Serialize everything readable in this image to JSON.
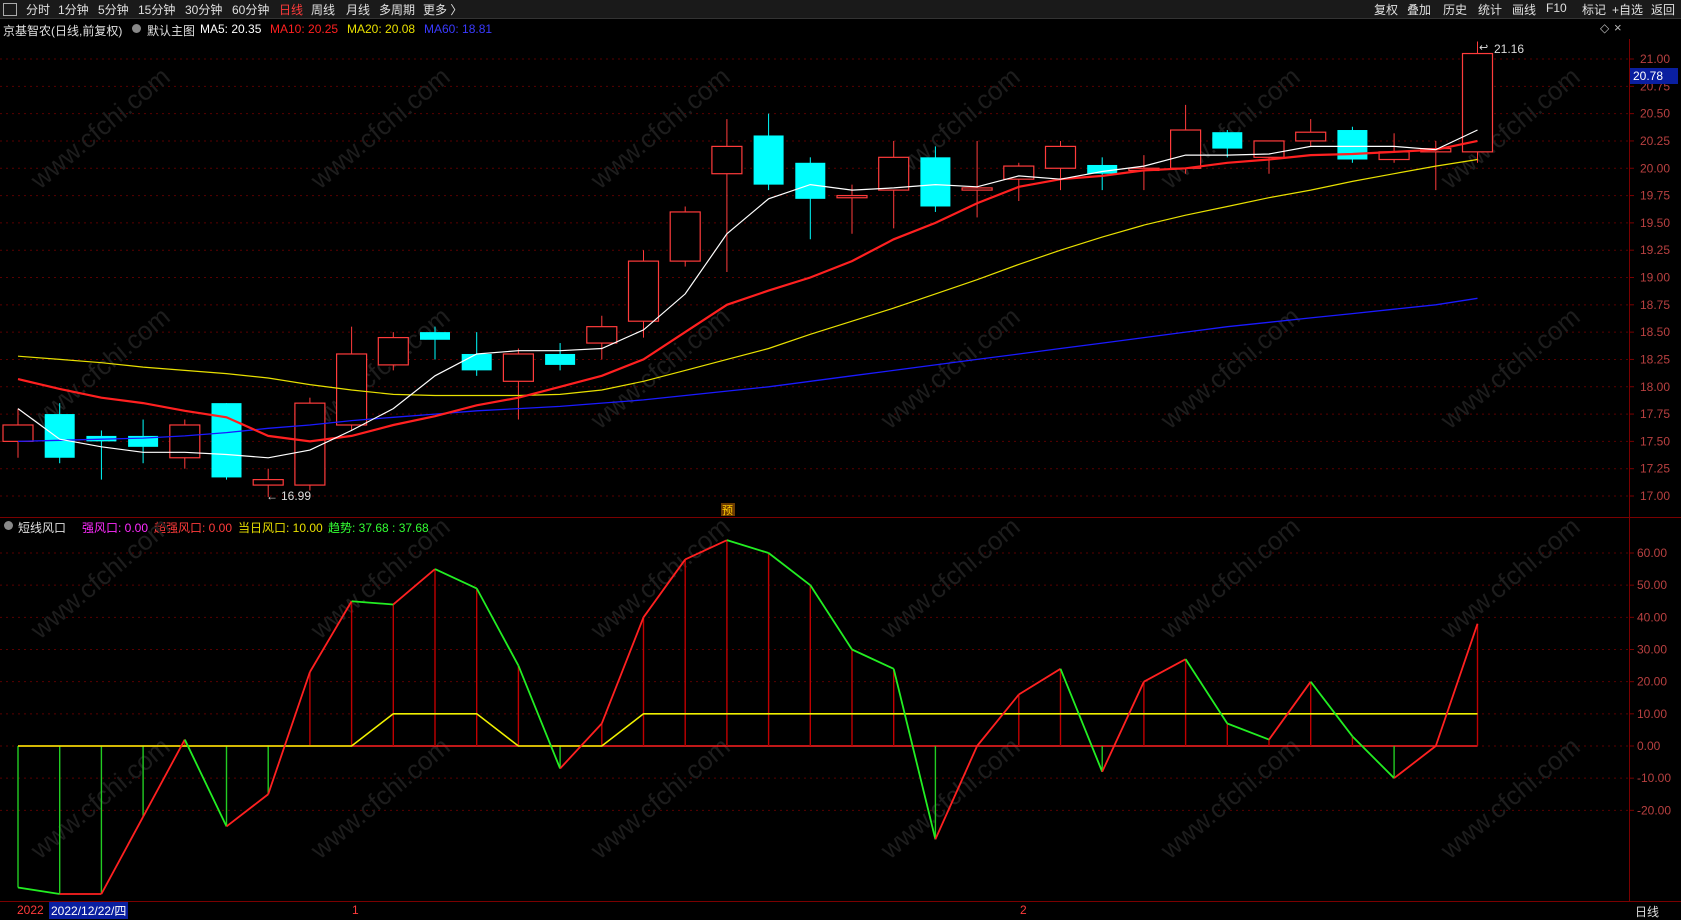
{
  "toolbar": {
    "left_icon": "sidebar-toggle-icon",
    "periods": [
      "分时",
      "1分钟",
      "5分钟",
      "15分钟",
      "30分钟",
      "60分钟",
      "日线",
      "周线",
      "月线",
      "多周期",
      "更多 〉"
    ],
    "active_period": "日线",
    "right_items": [
      "复权",
      "叠加",
      "历史",
      "统计",
      "画线",
      "F10",
      "+自选",
      "返回"
    ],
    "mark_label": "标记"
  },
  "main_chart": {
    "stock_title": "京基智农(日线,前复权)",
    "template_label": "默认主图",
    "ma5_label": "MA5: 20.35",
    "ma10_label": "MA10: 20.25",
    "ma20_label": "MA20: 20.08",
    "ma60_label": "MA60: 18.81",
    "colors": {
      "up": "#ff3b3b",
      "down": "#00ffff",
      "ma5": "#ffffff",
      "ma10": "#ff2020",
      "ma20": "#e8e000",
      "ma60": "#1a1aff"
    },
    "y_ticks": [
      "21.00",
      "20.75",
      "20.50",
      "20.25",
      "20.00",
      "19.75",
      "19.50",
      "19.25",
      "19.00",
      "18.75",
      "18.50",
      "18.25",
      "18.00",
      "17.75",
      "17.50",
      "17.25",
      "17.00"
    ],
    "current_price": "20.78",
    "high_marker": "21.16",
    "low_marker": "16.99",
    "pre_badge": "预"
  },
  "chart_data": [
    {
      "type": "candlestick",
      "title": "京基智农(日线,前复权)",
      "ylim": [
        16.9,
        21.2
      ],
      "candles": [
        {
          "o": 17.5,
          "c": 17.65,
          "h": 17.8,
          "l": 17.35
        },
        {
          "o": 17.75,
          "c": 17.35,
          "h": 17.85,
          "l": 17.3
        },
        {
          "o": 17.55,
          "c": 17.5,
          "h": 17.6,
          "l": 17.15
        },
        {
          "o": 17.55,
          "c": 17.45,
          "h": 17.7,
          "l": 17.3
        },
        {
          "o": 17.35,
          "c": 17.65,
          "h": 17.7,
          "l": 17.25
        },
        {
          "o": 17.85,
          "c": 17.17,
          "h": 17.85,
          "l": 17.15
        },
        {
          "o": 17.1,
          "c": 17.15,
          "h": 17.25,
          "l": 16.99
        },
        {
          "o": 17.1,
          "c": 17.85,
          "h": 17.9,
          "l": 17.05
        },
        {
          "o": 17.65,
          "c": 18.3,
          "h": 18.55,
          "l": 17.6
        },
        {
          "o": 18.2,
          "c": 18.45,
          "h": 18.5,
          "l": 18.15
        },
        {
          "o": 18.5,
          "c": 18.43,
          "h": 18.55,
          "l": 18.25
        },
        {
          "o": 18.3,
          "c": 18.15,
          "h": 18.5,
          "l": 18.1
        },
        {
          "o": 18.05,
          "c": 18.3,
          "h": 18.35,
          "l": 17.7
        },
        {
          "o": 18.3,
          "c": 18.2,
          "h": 18.4,
          "l": 18.15
        },
        {
          "o": 18.4,
          "c": 18.55,
          "h": 18.65,
          "l": 18.25
        },
        {
          "o": 18.6,
          "c": 19.15,
          "h": 19.25,
          "l": 18.45
        },
        {
          "o": 19.15,
          "c": 19.6,
          "h": 19.65,
          "l": 19.1
        },
        {
          "o": 19.95,
          "c": 20.2,
          "h": 20.45,
          "l": 19.05
        },
        {
          "o": 20.3,
          "c": 19.85,
          "h": 20.5,
          "l": 19.8
        },
        {
          "o": 20.05,
          "c": 19.72,
          "h": 20.1,
          "l": 19.35
        },
        {
          "o": 19.73,
          "c": 19.75,
          "h": 19.85,
          "l": 19.4
        },
        {
          "o": 19.8,
          "c": 20.1,
          "h": 20.25,
          "l": 19.45
        },
        {
          "o": 20.1,
          "c": 19.65,
          "h": 20.2,
          "l": 19.6
        },
        {
          "o": 19.8,
          "c": 19.82,
          "h": 20.25,
          "l": 19.55
        },
        {
          "o": 19.9,
          "c": 20.02,
          "h": 20.05,
          "l": 19.7
        },
        {
          "o": 20.0,
          "c": 20.2,
          "h": 20.25,
          "l": 19.8
        },
        {
          "o": 20.03,
          "c": 19.95,
          "h": 20.1,
          "l": 19.8
        },
        {
          "o": 19.98,
          "c": 20.0,
          "h": 20.12,
          "l": 19.8
        },
        {
          "o": 20.0,
          "c": 20.35,
          "h": 20.58,
          "l": 19.95
        },
        {
          "o": 20.33,
          "c": 20.18,
          "h": 20.35,
          "l": 20.1
        },
        {
          "o": 20.1,
          "c": 20.25,
          "h": 20.25,
          "l": 19.95
        },
        {
          "o": 20.25,
          "c": 20.33,
          "h": 20.45,
          "l": 20.2
        },
        {
          "o": 20.35,
          "c": 20.08,
          "h": 20.38,
          "l": 20.05
        },
        {
          "o": 20.08,
          "c": 20.15,
          "h": 20.32,
          "l": 20.05
        },
        {
          "o": 20.15,
          "c": 20.18,
          "h": 20.25,
          "l": 19.8
        },
        {
          "o": 20.15,
          "c": 21.05,
          "h": 21.16,
          "l": 20.05
        }
      ],
      "ma5": [
        17.8,
        17.52,
        17.45,
        17.4,
        17.4,
        17.38,
        17.35,
        17.42,
        17.6,
        17.8,
        18.1,
        18.3,
        18.33,
        18.33,
        18.35,
        18.52,
        18.85,
        19.4,
        19.72,
        19.85,
        19.8,
        19.82,
        19.85,
        19.83,
        19.93,
        19.9,
        19.97,
        20.02,
        20.12,
        20.12,
        20.13,
        20.2,
        20.2,
        20.2,
        20.17,
        20.35
      ],
      "ma10": [
        18.07,
        17.98,
        17.9,
        17.85,
        17.78,
        17.72,
        17.55,
        17.5,
        17.55,
        17.65,
        17.73,
        17.83,
        17.9,
        18.0,
        18.1,
        18.25,
        18.5,
        18.75,
        18.88,
        19.0,
        19.15,
        19.35,
        19.5,
        19.68,
        19.83,
        19.9,
        19.93,
        19.98,
        20.0,
        20.05,
        20.08,
        20.12,
        20.13,
        20.15,
        20.17,
        20.25
      ],
      "ma20": [
        18.28,
        18.25,
        18.22,
        18.18,
        18.15,
        18.12,
        18.08,
        18.02,
        17.97,
        17.93,
        17.92,
        17.92,
        17.92,
        17.93,
        17.97,
        18.05,
        18.15,
        18.25,
        18.35,
        18.48,
        18.6,
        18.72,
        18.85,
        18.98,
        19.12,
        19.25,
        19.37,
        19.48,
        19.57,
        19.65,
        19.73,
        19.8,
        19.88,
        19.95,
        20.02,
        20.08
      ],
      "ma60": [
        17.5,
        17.51,
        17.52,
        17.53,
        17.55,
        17.58,
        17.62,
        17.65,
        17.69,
        17.72,
        17.75,
        17.78,
        17.8,
        17.82,
        17.85,
        17.88,
        17.92,
        17.96,
        18.0,
        18.05,
        18.1,
        18.15,
        18.2,
        18.25,
        18.3,
        18.35,
        18.4,
        18.45,
        18.5,
        18.55,
        18.59,
        18.63,
        18.67,
        18.71,
        18.75,
        18.81
      ]
    },
    {
      "type": "line",
      "title": "短线风口",
      "ylim": [
        -30,
        67
      ],
      "series": [
        {
          "name": "趋势",
          "values": [
            -44,
            -46,
            -46,
            -22,
            2,
            -25,
            -15,
            23,
            45,
            44,
            55,
            49,
            25,
            -7,
            7,
            40,
            58,
            64,
            60,
            50,
            30,
            24,
            -29,
            0,
            16,
            24,
            -8,
            20,
            27,
            7,
            2,
            20,
            3,
            -10,
            0,
            38
          ]
        },
        {
          "name": "当日风口",
          "values": [
            0,
            0,
            0,
            0,
            0,
            0,
            0,
            0,
            0,
            10,
            10,
            10,
            0,
            0,
            0,
            10,
            10,
            10,
            10,
            10,
            10,
            10,
            10,
            10,
            10,
            10,
            10,
            10,
            10,
            10,
            10,
            10,
            10,
            10,
            10,
            10
          ]
        }
      ],
      "legend_values": {
        "强风口": "0.00",
        "超强风口": "0.00",
        "当日风口": "10.00",
        "趋势": "37.68 : 37.68"
      },
      "y_ticks": [
        "60.00",
        "50.00",
        "40.00",
        "30.00",
        "20.00",
        "10.00",
        "0.00",
        "-10.00",
        "-20.00"
      ]
    }
  ],
  "indicator": {
    "title": "短线风口",
    "strong_label": "强风口: 0.00",
    "super_strong_label": "超强风口: 0.00",
    "today_label": "当日风口: 10.00",
    "trend_label": "趋势: 37.68 : 37.68"
  },
  "bottom": {
    "year_label": "2022",
    "date_label": "2022/12/22/四",
    "month1": "1",
    "month2": "2",
    "period_label": "日线"
  },
  "watermark": "www.cfchi.com"
}
